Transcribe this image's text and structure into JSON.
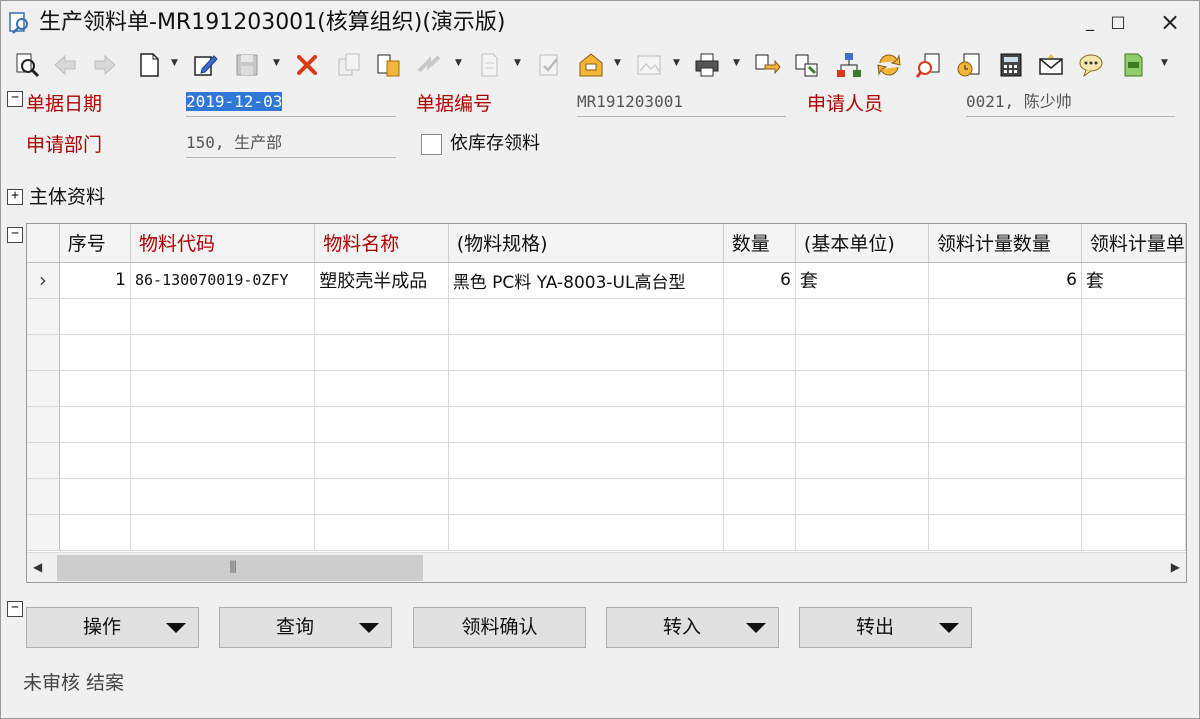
{
  "window": {
    "title": "生产领料单-MR191203001(核算组织)(演示版)",
    "minimize": "_",
    "maximize": "□",
    "close": "×"
  },
  "toolbar": {
    "icons": [
      "find-icon",
      "back-icon",
      "forward-icon",
      "new-icon",
      "edit-icon",
      "save-icon",
      "delete-icon",
      "copy-icon",
      "paste-icon",
      "transfer-icon",
      "doc-icon",
      "approve-icon",
      "archive-icon",
      "image-icon",
      "print-icon",
      "link-icon",
      "relate-icon",
      "flow-icon",
      "refresh-icon",
      "search-doc-icon",
      "clock-icon",
      "calculator-icon",
      "mail-icon",
      "chat-icon",
      "excel-icon"
    ]
  },
  "header": {
    "date_label": "单据日期",
    "date_value": "2019-12-03",
    "number_label": "单据编号",
    "number_value": "MR191203001",
    "applicant_label": "申请人员",
    "applicant_value": "0021, 陈少帅",
    "dept_label": "申请部门",
    "dept_value": "150, 生产部",
    "stock_checkbox_label": "依库存领料",
    "stock_checkbox_checked": false
  },
  "main_section": {
    "label": "主体资料"
  },
  "grid": {
    "columns": [
      "序号",
      "物料代码",
      "物料名称",
      "(物料规格)",
      "数量",
      "(基本单位)",
      "领料计量数量",
      "领料计量单"
    ],
    "rows": [
      {
        "seq": "1",
        "code": "86-130070019-0ZFY",
        "name": "塑胶壳半成品",
        "spec": "黑色 PC料 YA-8003-UL高台型",
        "qty": "6",
        "unit": "套",
        "issue_qty": "6",
        "issue_unit": "套"
      }
    ],
    "row_indicator": "›",
    "scroll_grip": "|||"
  },
  "buttons": {
    "operate": "操作",
    "query": "查询",
    "confirm": "领料确认",
    "transfer_in": "转入",
    "transfer_out": "转出"
  },
  "status": {
    "text": "未审核 结案"
  },
  "colors": {
    "label_red": "#b00000",
    "selection_blue": "#3078d8"
  }
}
